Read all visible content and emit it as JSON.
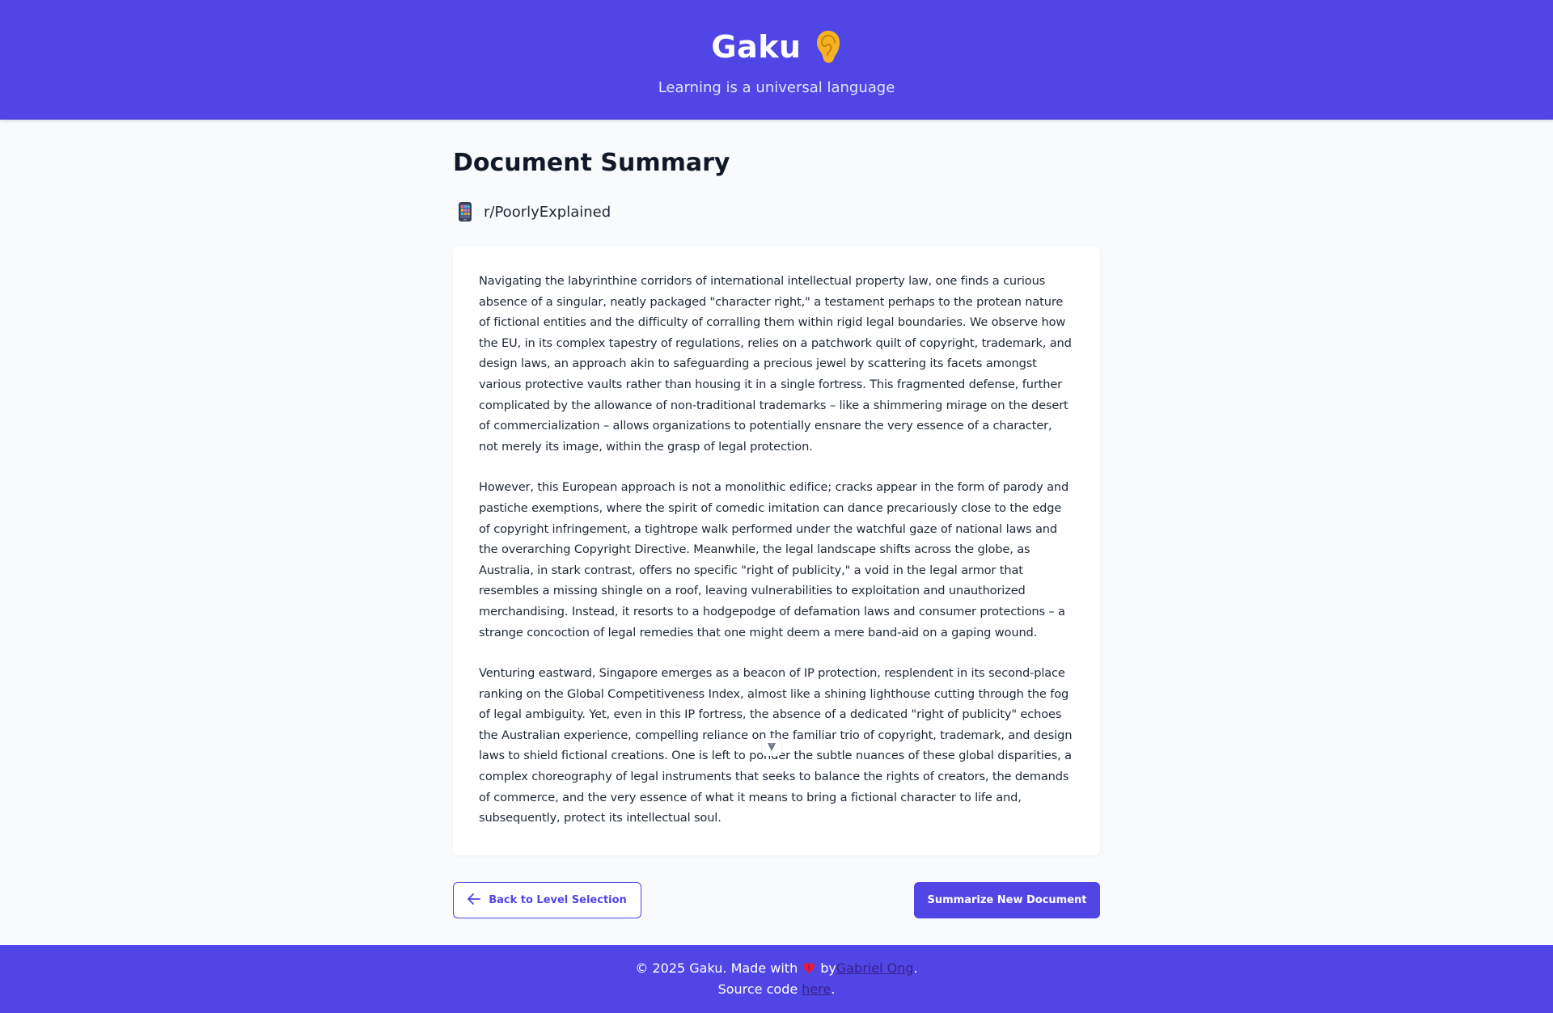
{
  "header": {
    "brand": "Gaku",
    "tagline": "Learning is a universal language"
  },
  "main": {
    "title": "Document Summary",
    "source": "r/PoorlyExplained",
    "paragraphs": [
      "Navigating the labyrinthine corridors of international intellectual property law, one finds a curious absence of a singular, neatly packaged \"character right,\" a testament perhaps to the protean nature of fictional entities and the difficulty of corralling them within rigid legal boundaries. We observe how the EU, in its complex tapestry of regulations, relies on a patchwork quilt of copyright, trademark, and design laws, an approach akin to safeguarding a precious jewel by scattering its facets amongst various protective vaults rather than housing it in a single fortress. This fragmented defense, further complicated by the allowance of non-traditional trademarks – like a shimmering mirage on the desert of commercialization – allows organizations to potentially ensnare the very essence of a character, not merely its image, within the grasp of legal protection.",
      "However, this European approach is not a monolithic edifice; cracks appear in the form of parody and pastiche exemptions, where the spirit of comedic imitation can dance precariously close to the edge of copyright infringement, a tightrope walk performed under the watchful gaze of national laws and the overarching Copyright Directive. Meanwhile, the legal landscape shifts across the globe, as Australia, in stark contrast, offers no specific \"right of publicity,\" a void in the legal armor that resembles a missing shingle on a roof, leaving vulnerabilities to exploitation and unauthorized merchandising. Instead, it resorts to a hodgepodge of defamation laws and consumer protections – a strange concoction of legal remedies that one might deem a mere band-aid on a gaping wound.",
      "Venturing eastward, Singapore emerges as a beacon of IP protection, resplendent in its second-place ranking on the Global Competitiveness Index, almost like a shining lighthouse cutting through the fog of legal ambiguity. Yet, even in this IP fortress, the absence of a dedicated \"right of publicity\" echoes the Australian experience, compelling reliance on the familiar trio of copyright, trademark, and design laws to shield fictional creations. One is left to ponder the subtle nuances of these global disparities, a complex choreography of legal instruments that seeks to balance the rights of creators, the demands of commerce, and the very essence of what it means to bring a fictional character to life and, subsequently, protect its intellectual soul."
    ]
  },
  "actions": {
    "back_label": "Back to Level Selection",
    "new_label": "Summarize New Document"
  },
  "footer": {
    "copyright_prefix": "© 2025 Gaku. Made with",
    "by_text": "by",
    "author_link": "Gabriel Ong",
    "period": ".",
    "source_prefix": "Source code",
    "source_link": "here",
    "source_period": "."
  },
  "icons": {
    "brand_icon": "ear-icon",
    "source_icon": "mobile-phone-icon",
    "back_icon": "arrow-left-icon",
    "footer_icon": "heart-icon"
  },
  "colors": {
    "primary": "#4f46e5",
    "background": "#f9fafb",
    "card": "#ffffff",
    "text": "#1f2937",
    "heart": "#e11d48"
  }
}
